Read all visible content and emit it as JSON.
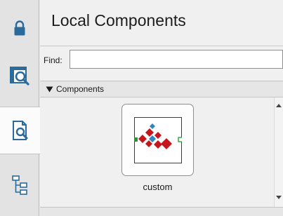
{
  "panel": {
    "title": "Local Components",
    "find_label": "Find:",
    "find_value": "",
    "find_placeholder": "",
    "section_label": "Components"
  },
  "sidebar": {
    "buttons": [
      {
        "icon": "lock-icon",
        "active": false
      },
      {
        "icon": "explore-window-icon",
        "active": false
      },
      {
        "icon": "document-search-icon",
        "active": true
      },
      {
        "icon": "tree-hierarchy-icon",
        "active": false
      }
    ]
  },
  "components": [
    {
      "label": "custom",
      "icon": "custom-component-icon"
    }
  ],
  "colors": {
    "accent": "#2e6f9e",
    "diamond_red": "#c4161c",
    "diamond_blue": "#2e86c1",
    "port_green": "#1f9d2b"
  }
}
